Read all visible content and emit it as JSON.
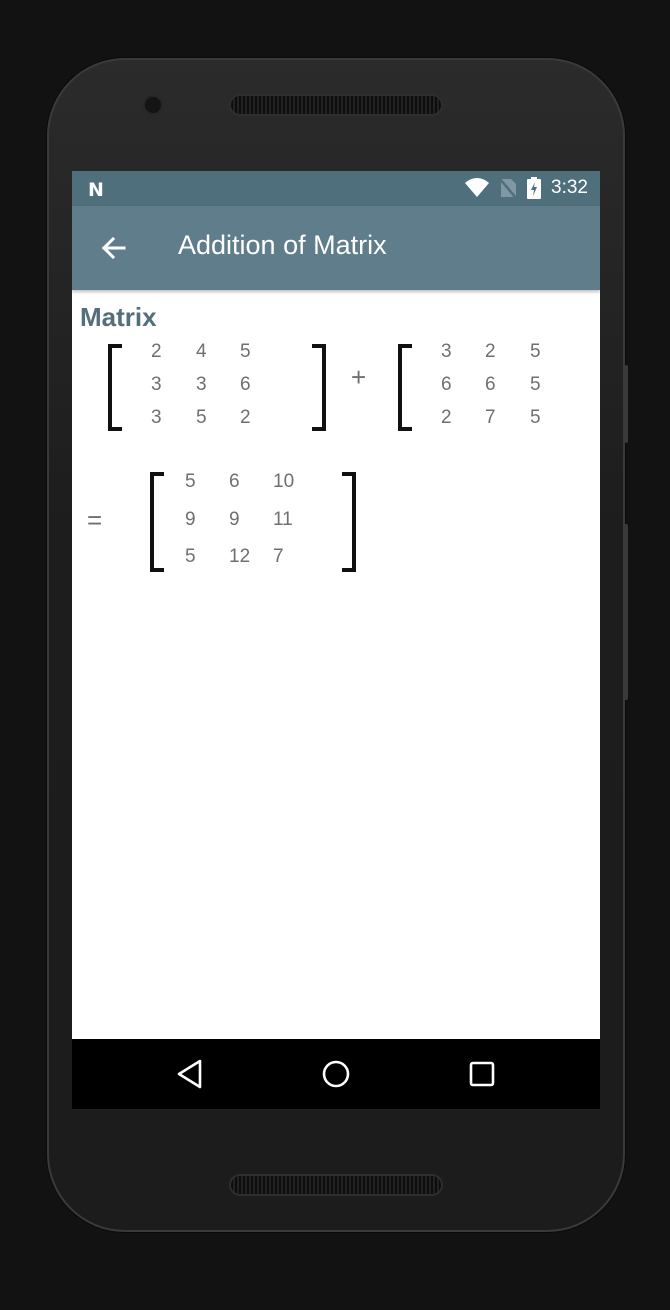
{
  "status_bar": {
    "time": "3:32",
    "icons": [
      "n-logo-icon",
      "wifi-icon",
      "no-sim-icon",
      "battery-charging-icon"
    ]
  },
  "app_bar": {
    "title": "Addition of Matrix",
    "back_icon": "arrow-left-icon"
  },
  "content": {
    "heading": "Matrix",
    "plus_sign": "+",
    "equals_sign": "=",
    "matrix_a": [
      [
        "2",
        "4",
        "5"
      ],
      [
        "3",
        "3",
        "6"
      ],
      [
        "3",
        "5",
        "2"
      ]
    ],
    "matrix_b": [
      [
        "3",
        "2",
        "5"
      ],
      [
        "6",
        "6",
        "5"
      ],
      [
        "2",
        "7",
        "5"
      ]
    ],
    "result": [
      [
        "5",
        "6",
        "10"
      ],
      [
        "9",
        "9",
        "11"
      ],
      [
        "5",
        "12",
        "7"
      ]
    ]
  },
  "nav_bar": {
    "icons": [
      "back-triangle-icon",
      "home-circle-icon",
      "recents-square-icon"
    ]
  },
  "colors": {
    "status_bar": "#4f6f7c",
    "app_bar": "#607d8b",
    "heading": "#546e7a",
    "cell_text": "#6f6f6f"
  }
}
